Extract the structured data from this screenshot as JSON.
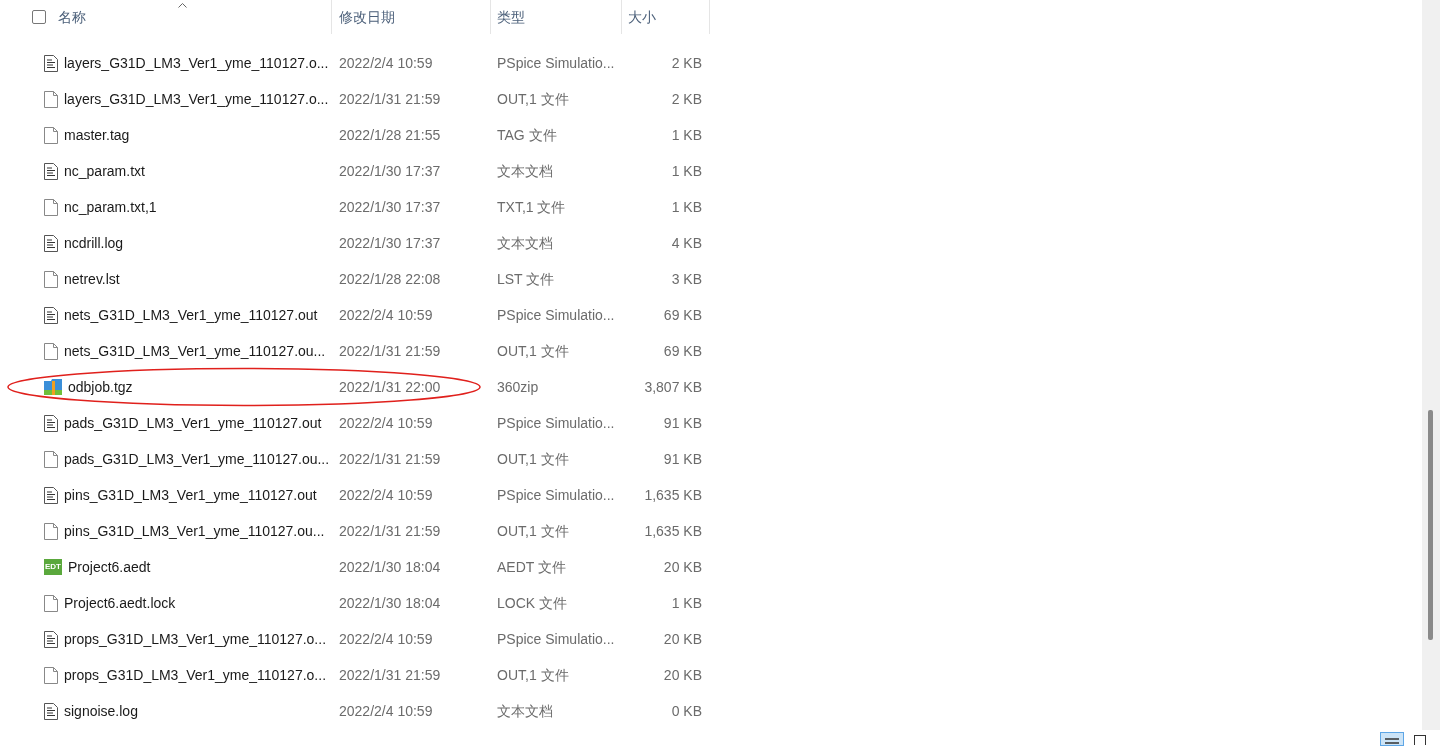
{
  "header": {
    "columns": [
      {
        "label": "名称",
        "sorted": true
      },
      {
        "label": "修改日期",
        "sorted": false
      },
      {
        "label": "类型",
        "sorted": false
      },
      {
        "label": "大小",
        "sorted": false
      }
    ],
    "select_all_checked": false
  },
  "files": [
    {
      "kind": "text",
      "name": "layers_G31D_LM3_Ver1_yme_110127.o...",
      "date": "2022/2/4 10:59",
      "type": "PSpice Simulatio...",
      "size": "2 KB",
      "circled": false
    },
    {
      "kind": "blank",
      "name": "layers_G31D_LM3_Ver1_yme_110127.o...",
      "date": "2022/1/31 21:59",
      "type": "OUT,1 文件",
      "size": "2 KB",
      "circled": false
    },
    {
      "kind": "blank",
      "name": "master.tag",
      "date": "2022/1/28 21:55",
      "type": "TAG 文件",
      "size": "1 KB",
      "circled": false
    },
    {
      "kind": "text",
      "name": "nc_param.txt",
      "date": "2022/1/30 17:37",
      "type": "文本文档",
      "size": "1 KB",
      "circled": false
    },
    {
      "kind": "blank",
      "name": "nc_param.txt,1",
      "date": "2022/1/30 17:37",
      "type": "TXT,1 文件",
      "size": "1 KB",
      "circled": false
    },
    {
      "kind": "text",
      "name": "ncdrill.log",
      "date": "2022/1/30 17:37",
      "type": "文本文档",
      "size": "4 KB",
      "circled": false
    },
    {
      "kind": "blank",
      "name": "netrev.lst",
      "date": "2022/1/28 22:08",
      "type": "LST 文件",
      "size": "3 KB",
      "circled": false
    },
    {
      "kind": "text",
      "name": "nets_G31D_LM3_Ver1_yme_110127.out",
      "date": "2022/2/4 10:59",
      "type": "PSpice Simulatio...",
      "size": "69 KB",
      "circled": false
    },
    {
      "kind": "blank",
      "name": "nets_G31D_LM3_Ver1_yme_110127.ou...",
      "date": "2022/1/31 21:59",
      "type": "OUT,1 文件",
      "size": "69 KB",
      "circled": false
    },
    {
      "kind": "archive",
      "name": "odbjob.tgz",
      "date": "2022/1/31 22:00",
      "type": "360zip",
      "size": "3,807 KB",
      "circled": true
    },
    {
      "kind": "text",
      "name": "pads_G31D_LM3_Ver1_yme_110127.out",
      "date": "2022/2/4 10:59",
      "type": "PSpice Simulatio...",
      "size": "91 KB",
      "circled": false
    },
    {
      "kind": "blank",
      "name": "pads_G31D_LM3_Ver1_yme_110127.ou...",
      "date": "2022/1/31 21:59",
      "type": "OUT,1 文件",
      "size": "91 KB",
      "circled": false
    },
    {
      "kind": "text",
      "name": "pins_G31D_LM3_Ver1_yme_110127.out",
      "date": "2022/2/4 10:59",
      "type": "PSpice Simulatio...",
      "size": "1,635 KB",
      "circled": false
    },
    {
      "kind": "blank",
      "name": "pins_G31D_LM3_Ver1_yme_110127.ou...",
      "date": "2022/1/31 21:59",
      "type": "OUT,1 文件",
      "size": "1,635 KB",
      "circled": false
    },
    {
      "kind": "edt",
      "icon_text": "EDT",
      "name": "Project6.aedt",
      "date": "2022/1/30 18:04",
      "type": "AEDT 文件",
      "size": "20 KB",
      "circled": false
    },
    {
      "kind": "blank",
      "name": "Project6.aedt.lock",
      "date": "2022/1/30 18:04",
      "type": "LOCK 文件",
      "size": "1 KB",
      "circled": false
    },
    {
      "kind": "text",
      "name": "props_G31D_LM3_Ver1_yme_110127.o...",
      "date": "2022/2/4 10:59",
      "type": "PSpice Simulatio...",
      "size": "20 KB",
      "circled": false
    },
    {
      "kind": "blank",
      "name": "props_G31D_LM3_Ver1_yme_110127.o...",
      "date": "2022/1/31 21:59",
      "type": "OUT,1 文件",
      "size": "20 KB",
      "circled": false
    },
    {
      "kind": "text",
      "name": "signoise.log",
      "date": "2022/2/4 10:59",
      "type": "文本文档",
      "size": "0 KB",
      "circled": false
    }
  ],
  "view_buttons": [
    {
      "kind": "details",
      "selected": true
    },
    {
      "kind": "tiles",
      "selected": false
    }
  ]
}
